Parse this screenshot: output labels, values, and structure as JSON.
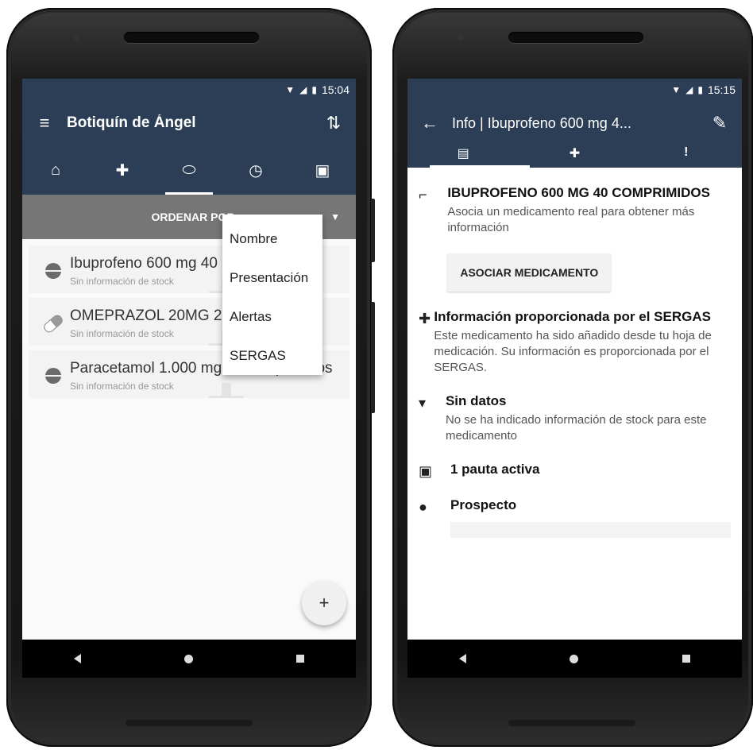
{
  "left_phone": {
    "status": {
      "time": "15:04"
    },
    "toolbar": {
      "title": "Botiquín de Ángel",
      "menu_icon": "menu-icon",
      "sort_icon": "sort-icon"
    },
    "tabs": [
      {
        "icon": "home-icon",
        "glyph": "⌂"
      },
      {
        "icon": "hospital-cross-icon",
        "glyph": "✚"
      },
      {
        "icon": "pill-icon",
        "glyph": "⬭"
      },
      {
        "icon": "alarm-icon",
        "glyph": "◷"
      },
      {
        "icon": "calendar-icon",
        "glyph": "▣"
      }
    ],
    "sortbar": {
      "label": "ORDENAR POR:",
      "caret": "▼"
    },
    "sort_menu": [
      "Nombre",
      "Presentación",
      "Alertas",
      "SERGAS"
    ],
    "medications": [
      {
        "name": "Ibuprofeno 600 mg 40 comprimidos",
        "stock": "Sin información de stock",
        "icon": "round-pill-icon"
      },
      {
        "name": "OMEPRAZOL 20MG 28 CAPSULAS",
        "stock": "Sin información de stock",
        "icon": "capsule-icon"
      },
      {
        "name": "Paracetamol 1.000 mg 40 comprimidos",
        "stock": "Sin información de stock",
        "icon": "round-pill-icon"
      }
    ],
    "fab": "+"
  },
  "right_phone": {
    "status": {
      "time": "15:15"
    },
    "toolbar": {
      "title": "Info | Ibuprofeno 600 mg 4...",
      "back_icon": "arrow-back-icon",
      "edit_icon": "edit-icon"
    },
    "tabs": [
      {
        "icon": "info-card-icon",
        "glyph": "▤"
      },
      {
        "icon": "hospital-cross-icon",
        "glyph": "✚"
      },
      {
        "icon": "alert-message-icon",
        "glyph": "!"
      }
    ],
    "sections": {
      "med": {
        "title": "IBUPROFENO 600 MG 40 COMPRIMIDOS",
        "text": "Asocia un medicamento real para obtener más información",
        "button": "ASOCIAR MEDICAMENTO"
      },
      "sergas": {
        "title": "Información proporcionada por el SERGAS",
        "text": "Este medicamento ha sido añadido desde tu hoja de medicación. Su información es proporcionada por el SERGAS."
      },
      "stock": {
        "title": "Sin datos",
        "text": "No se ha indicado información de stock para este medicamento"
      },
      "schedule": {
        "title": "1 pauta activa"
      },
      "prospect": {
        "title": "Prospecto"
      }
    }
  }
}
